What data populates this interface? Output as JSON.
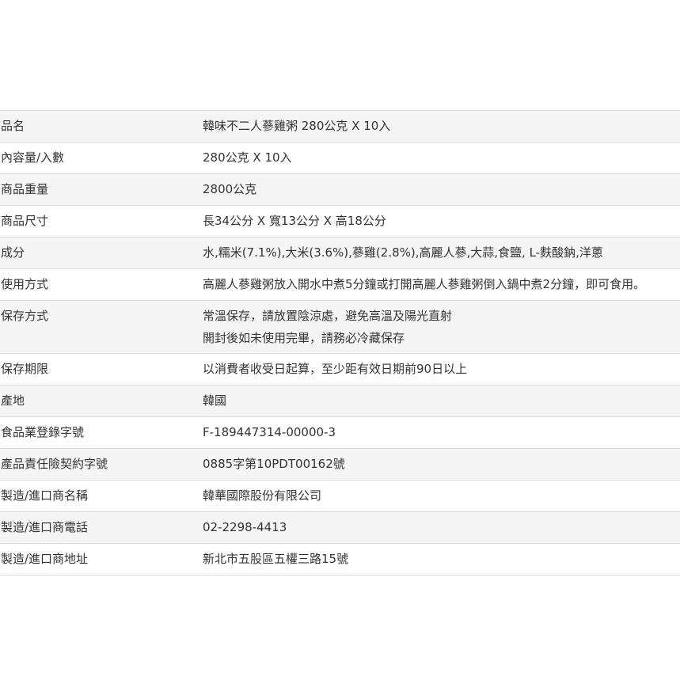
{
  "specs": [
    {
      "label": "品名",
      "lines": [
        "韓味不二人蔘雞粥 280公克 X 10入"
      ]
    },
    {
      "label": "內容量/入數",
      "lines": [
        "280公克 X 10入"
      ]
    },
    {
      "label": "商品重量",
      "lines": [
        "2800公克"
      ]
    },
    {
      "label": "商品尺寸",
      "lines": [
        "長34公分 X 寬13公分 X 高18公分"
      ]
    },
    {
      "label": "成分",
      "lines": [
        "水,糯米(7.1%),大米(3.6%),蔘雞(2.8%),高麗人蔘,大蒜,食鹽, L-麩酸鈉,洋蔥"
      ]
    },
    {
      "label": "使用方式",
      "lines": [
        "高麗人蔘雞粥放入開水中煮5分鐘或打開高麗人蔘雞粥倒入鍋中煮2分鐘，即可食用。"
      ]
    },
    {
      "label": "保存方式",
      "lines": [
        "常溫保存，請放置陰涼處，避免高溫及陽光直射",
        "開封後如未使用完畢，請務必冷藏保存"
      ]
    },
    {
      "label": "保存期限",
      "lines": [
        "以消費者收受日起算，至少距有效日期前90日以上"
      ]
    },
    {
      "label": "產地",
      "lines": [
        "韓國"
      ]
    },
    {
      "label": "食品業登錄字號",
      "lines": [
        "F-189447314-00000-3"
      ]
    },
    {
      "label": "產品責任險契約字號",
      "lines": [
        "0885字第10PDT00162號"
      ]
    },
    {
      "label": "製造/進口商名稱",
      "lines": [
        "韓華國際股份有限公司"
      ]
    },
    {
      "label": "製造/進口商電話",
      "lines": [
        "02-2298-4413"
      ]
    },
    {
      "label": "製造/進口商地址",
      "lines": [
        "新北市五股區五權三路15號"
      ]
    }
  ]
}
